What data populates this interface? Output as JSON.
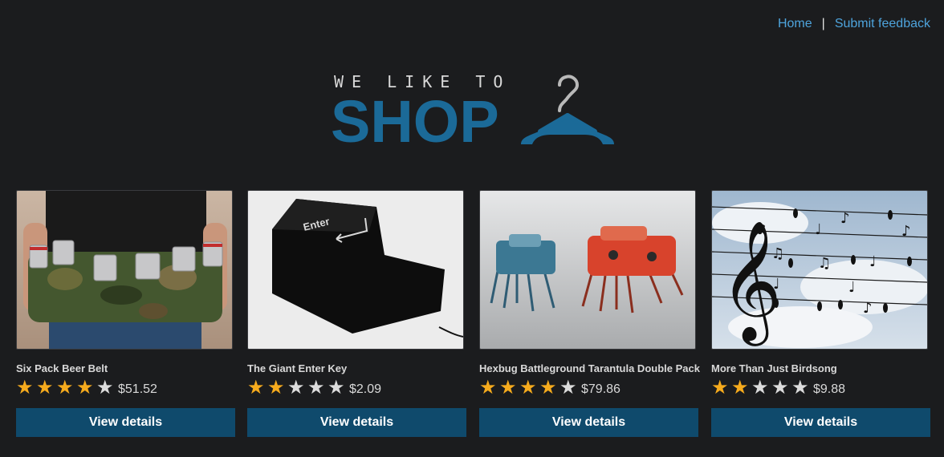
{
  "nav": {
    "home": "Home",
    "separator": "|",
    "feedback": "Submit feedback"
  },
  "logo": {
    "tagline": "WE LIKE TO",
    "word": "SHOP",
    "icon": "hanger-icon"
  },
  "products": [
    {
      "title": "Six Pack Beer Belt",
      "rating": 4,
      "price": "$51.52",
      "button": "View details",
      "image": "beer-belt-image"
    },
    {
      "title": "The Giant Enter Key",
      "rating": 2,
      "price": "$2.09",
      "button": "View details",
      "image": "enter-key-image"
    },
    {
      "title": "Hexbug Battleground Tarantula Double Pack",
      "rating": 4,
      "price": "$79.86",
      "button": "View details",
      "image": "hexbug-image"
    },
    {
      "title": "More Than Just Birdsong",
      "rating": 2,
      "price": "$9.88",
      "button": "View details",
      "image": "birdsong-image"
    }
  ],
  "colors": {
    "background": "#1b1c1e",
    "link": "#4ea4dd",
    "brand": "#1b6a98",
    "button": "#0f4a6c",
    "star": "#f6ab1d"
  }
}
